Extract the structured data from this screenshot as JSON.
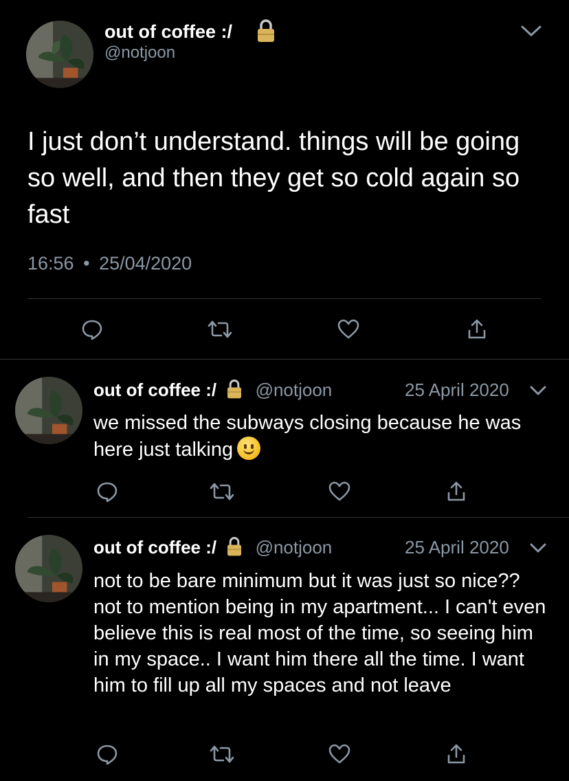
{
  "main_tweet": {
    "display_name": "out of coffee :/",
    "handle": "@notjoon",
    "text": "I just don’t understand. things will be going so well, and then they get so cold again so fast",
    "time": "16:56",
    "separator": "•",
    "date": "25/04/2020",
    "icons": [
      "lock-icon",
      "chevron-down-icon",
      "reply-icon",
      "retweet-icon",
      "like-icon",
      "share-icon"
    ]
  },
  "replies": [
    {
      "display_name": "out of coffee :/",
      "handle": "@notjoon",
      "date": "25 April 2020",
      "text": "we missed the subways closing because he was here just talking",
      "emoji": "slightly-smiling-face"
    },
    {
      "display_name": "out of coffee :/",
      "handle": "@notjoon",
      "date": "25 April 2020",
      "text": "not to be bare minimum but it was just so nice?? not to mention being in my apartment... I can't even believe this is real most of the time, so seeing him in my space.. I want him there all the time. I want him to fill up all my spaces and not leave"
    }
  ],
  "colors": {
    "background": "#000000",
    "text": "#ffffff",
    "muted": "#8b98a5",
    "divider": "#2f3336",
    "lock": "#d9b45a"
  }
}
